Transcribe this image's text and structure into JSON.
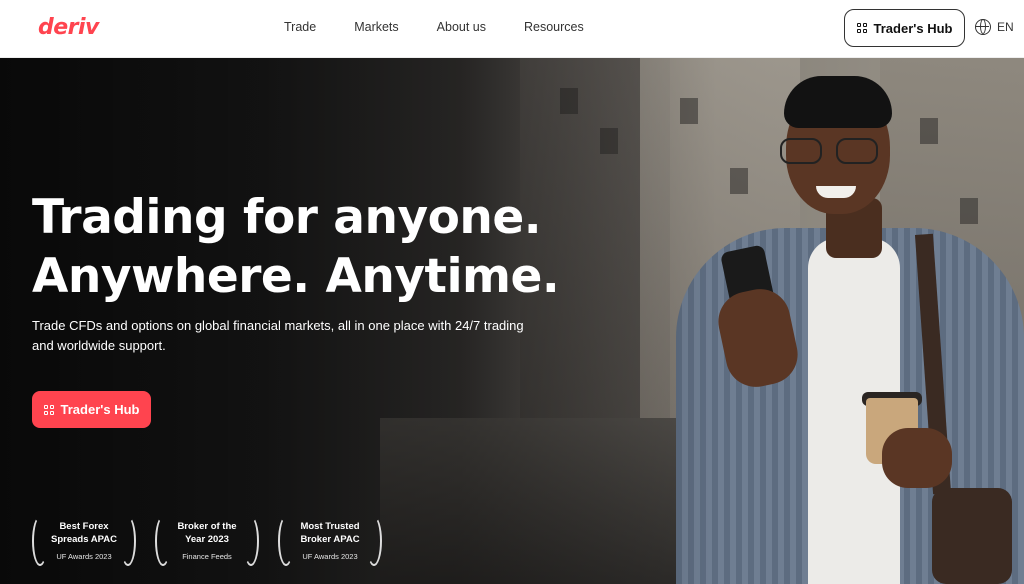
{
  "header": {
    "logo": "deriv",
    "nav": [
      "Trade",
      "Markets",
      "About us",
      "Resources"
    ],
    "hub_button": "Trader's Hub",
    "language": "EN"
  },
  "hero": {
    "title_line1": "Trading for anyone.",
    "title_line2": "Anywhere. Anytime.",
    "subtitle": "Trade CFDs and options on global financial markets, all in one place with 24/7 trading and worldwide support.",
    "cta": "Trader's Hub"
  },
  "awards": [
    {
      "title": "Best Forex Spreads APAC",
      "source": "UF Awards 2023"
    },
    {
      "title": "Broker of the Year 2023",
      "source": "Finance Feeds"
    },
    {
      "title": "Most Trusted Broker APAC",
      "source": "UF Awards 2023"
    }
  ],
  "colors": {
    "brand": "#ff444f",
    "header_bg": "#ffffff",
    "hero_text": "#ffffff"
  },
  "icons": {
    "hub": "grid-icon",
    "language": "globe-icon",
    "award": "laurel-icon"
  }
}
